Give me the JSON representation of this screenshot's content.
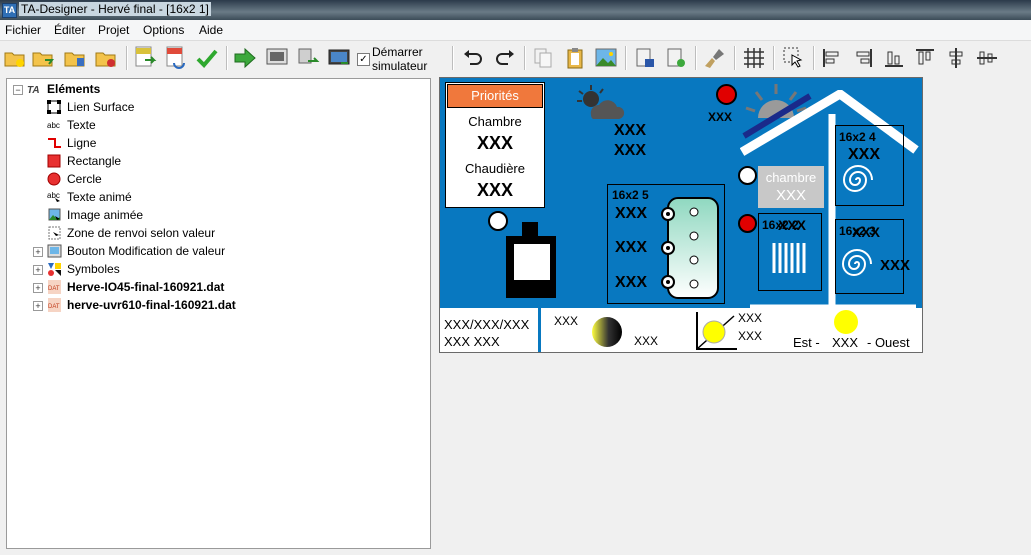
{
  "window": {
    "title": "TA-Designer - Hervé final - [16x2 1]",
    "icon": "TA"
  },
  "menu": [
    "Fichier",
    "Éditer",
    "Projet",
    "Options",
    "Aide"
  ],
  "toolbar": {
    "simulate_label": "Démarrer\nsimulateur"
  },
  "tree": {
    "root": "Eléments",
    "items": [
      {
        "label": "Lien Surface"
      },
      {
        "label": "Texte"
      },
      {
        "label": "Ligne"
      },
      {
        "label": "Rectangle"
      },
      {
        "label": "Cercle"
      },
      {
        "label": "Texte animé"
      },
      {
        "label": "Image animée"
      },
      {
        "label": "Zone de renvoi selon valeur"
      },
      {
        "label": "Bouton Modification de valeur"
      },
      {
        "label": "Symboles"
      },
      {
        "label": "Herve-IO45-final-160921.dat"
      },
      {
        "label": "herve-uvr610-final-160921.dat"
      }
    ]
  },
  "canvas": {
    "priorites": "Priorités",
    "chambre": "Chambre",
    "chaudiere": "Chaudière",
    "xxx": "XXX",
    "panel5": "16x2 5",
    "panel4": "16x2 4",
    "panel2": "16x2 2",
    "panel3": "16x2 3",
    "chambre_small": "chambre",
    "bottom_left1": "XXX/XXX/XXX",
    "bottom_left2": "XXX XXX",
    "est": "Est -",
    "ouest": "- Ouest",
    "colors": {
      "bg": "#0878c0",
      "orange": "#f0783c",
      "red": "#e00000",
      "yellow": "#ffff00"
    }
  }
}
